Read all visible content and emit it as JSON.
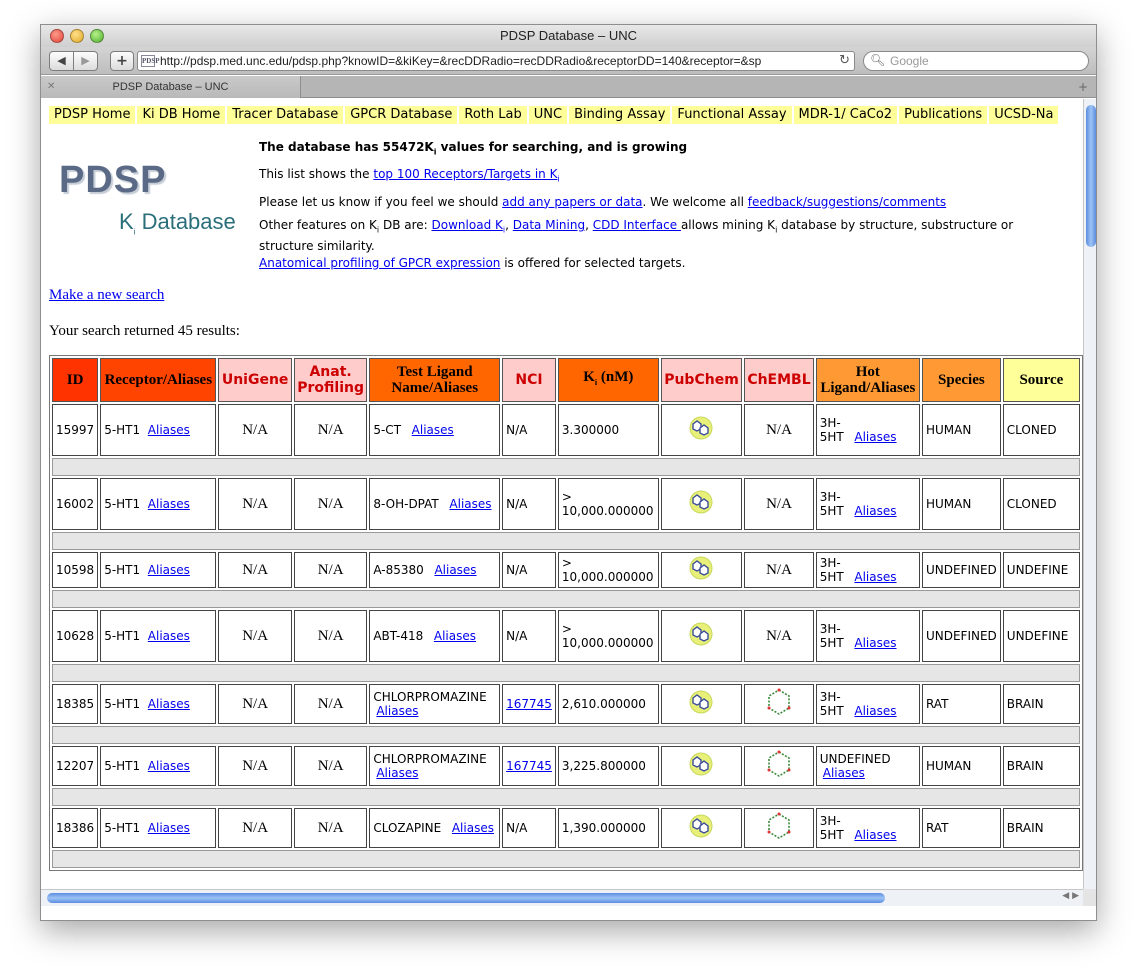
{
  "window": {
    "title": "PDSP Database – UNC",
    "tab_label": "PDSP Database – UNC"
  },
  "toolbar": {
    "back_label": "◀",
    "forward_label": "▶",
    "add_label": "+",
    "url": "http://pdsp.med.unc.edu/pdsp.php?knowID=&kiKey=&recDDRadio=recDDRadio&receptorDD=140&receptor=&sp",
    "reload_icon": "↻",
    "search_placeholder": "Google",
    "favicon_text": "PDSP"
  },
  "nav": [
    "PDSP Home",
    "Ki DB Home",
    "Tracer Database",
    "GPCR Database",
    "Roth Lab",
    "UNC",
    "Binding Assay",
    "Functional Assay",
    "MDR-1/ CaCo2",
    "Publications",
    "UCSD-Na"
  ],
  "logo": {
    "title": "PDSP",
    "subtitle_k": "K",
    "subtitle_i": "i",
    "subtitle_rest": " Database"
  },
  "info": {
    "headline_pre": "The database has 55472K",
    "headline_sub": "i",
    "headline_post": " values for searching, and is growing",
    "line2_pre": "This list shows the ",
    "line2_link": "top 100 Receptors/Targets in K",
    "line2_link_sub": "i",
    "line3_pre": "Please let us know if you feel we should ",
    "line3_link1": "add any papers or data",
    "line3_mid": ". We welcome all ",
    "line3_link2": "feedback/suggestions/comments",
    "line4_pre": "Other features on K",
    "line4_sub": "i",
    "line4_mid": " DB are: ",
    "line4_link1": "Download K",
    "line4_link1_sub": "i",
    "line4_sep": ", ",
    "line4_link2": "Data Mining",
    "line4_sep2": ", ",
    "line4_link3": "CDD Interface ",
    "line4_post": "allows mining K",
    "line4_post_sub": "i",
    "line4_post2": " database by structure, substructure or structure similarity.",
    "line5_link": "Anatomical profiling of GPCR expression",
    "line5_post": " is offered for selected targets."
  },
  "new_search_label": "Make a new search",
  "results_text": "Your search returned 45 results:",
  "colors": {
    "id": "#ff3300",
    "receptor": "#ff4400",
    "pink": "#ffcccc",
    "orange": "#ff6600",
    "light_orange": "#ff9933",
    "yellow": "#ffff99",
    "nav_yellow": "#ffff99"
  },
  "table": {
    "headers": {
      "id": "ID",
      "receptor": "Receptor/Aliases",
      "unigene": "UniGene",
      "anat": "Anat. Profiling",
      "ligand": "Test Ligand Name/Aliases",
      "nci": "NCI",
      "ki_pre": "K",
      "ki_sub": "i",
      "ki_post": " (nM)",
      "pubchem": "PubChem",
      "chembl": "ChEMBL",
      "hot": "Hot Ligand/Aliases",
      "species": "Species",
      "source": "Source"
    },
    "aliases_label": "Aliases",
    "rows": [
      {
        "id": "15997",
        "receptor": "5-HT1",
        "unigene": "N/A",
        "anat": "N/A",
        "ligand": "5-CT",
        "nci": "N/A",
        "ki": "3.300000",
        "chembl": "N/A",
        "hot": "3H-5HT",
        "species": "HUMAN",
        "source": "CLONED"
      },
      {
        "id": "16002",
        "receptor": "5-HT1",
        "unigene": "N/A",
        "anat": "N/A",
        "ligand": "8-OH-DPAT",
        "nci": "N/A",
        "ki": "> 10,000.000000",
        "chembl": "N/A",
        "hot": "3H-5HT",
        "species": "HUMAN",
        "source": "CLONED"
      },
      {
        "id": "10598",
        "receptor": "5-HT1",
        "unigene": "N/A",
        "anat": "N/A",
        "ligand": "A-85380",
        "nci": "N/A",
        "ki": "> 10,000.000000",
        "chembl": "N/A",
        "hot": "3H-5HT",
        "species": "UNDEFINED",
        "source": "UNDEFINE"
      },
      {
        "id": "10628",
        "receptor": "5-HT1",
        "unigene": "N/A",
        "anat": "N/A",
        "ligand": "ABT-418",
        "nci": "N/A",
        "ki": "> 10,000.000000",
        "chembl": "N/A",
        "hot": "3H-5HT",
        "species": "UNDEFINED",
        "source": "UNDEFINE"
      },
      {
        "id": "18385",
        "receptor": "5-HT1",
        "unigene": "N/A",
        "anat": "N/A",
        "ligand": "CHLORPROMAZINE",
        "nci": "167745",
        "ki": "2,610.000000",
        "chembl": "",
        "hot": "3H-5HT",
        "species": "RAT",
        "source": "BRAIN"
      },
      {
        "id": "12207",
        "receptor": "5-HT1",
        "unigene": "N/A",
        "anat": "N/A",
        "ligand": "CHLORPROMAZINE",
        "nci": "167745",
        "ki": "3,225.800000",
        "chembl": "",
        "hot": "UNDEFINED",
        "species": "HUMAN",
        "source": "BRAIN"
      },
      {
        "id": "18386",
        "receptor": "5-HT1",
        "unigene": "N/A",
        "anat": "N/A",
        "ligand": "CLOZAPINE",
        "nci": "N/A",
        "ki": "1,390.000000",
        "chembl": "",
        "hot": "3H-5HT",
        "species": "RAT",
        "source": "BRAIN"
      }
    ]
  }
}
